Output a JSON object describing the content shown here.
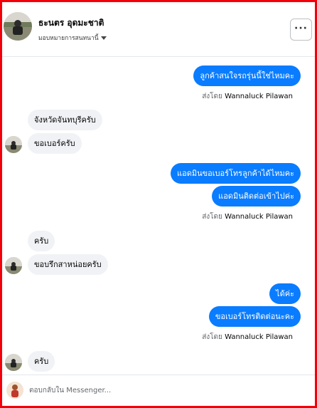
{
  "header": {
    "name": "ธะนตร อุดมะชาติ",
    "subtitle": "มอบหมายการสนทนานี้",
    "more_label": "···"
  },
  "messages": [
    {
      "type": "out",
      "text": "ลูกค้าสนใจรถรุ่นนี้ใช่ไหมคะ"
    },
    {
      "type": "sentby",
      "prefix": "ส่งโดย",
      "agent": "Wannaluck Pilawan"
    },
    {
      "type": "in",
      "text": "จังหวัดจันทบุรีครับ"
    },
    {
      "type": "in",
      "text": "ขอเบอร์ครับ"
    },
    {
      "type": "out",
      "text": "แอดมินขอเบอร์โทรลูกค้าได้ไหมคะ"
    },
    {
      "type": "out",
      "text": "แอดมินติดต่อเข้าไปค่ะ"
    },
    {
      "type": "sentby",
      "prefix": "ส่งโดย",
      "agent": "Wannaluck Pilawan"
    },
    {
      "type": "in",
      "text": "ครับ"
    },
    {
      "type": "in",
      "text": "ขอบรึกสาหน่อยครับ"
    },
    {
      "type": "out",
      "text": "ได้ค่ะ"
    },
    {
      "type": "out",
      "text": "ขอเบอร์โทรติดต่อนะคะ"
    },
    {
      "type": "sentby",
      "prefix": "ส่งโดย",
      "agent": "Wannaluck Pilawan"
    },
    {
      "type": "in",
      "text": "ครับ"
    }
  ],
  "footer": {
    "placeholder": "ตอบกลับใน Messenger..."
  },
  "colors": {
    "outgoing_bubble": "#0a7cff",
    "incoming_bubble": "#f0f2f5",
    "frame_border": "#f2000a"
  },
  "icons": [
    "more-options-icon",
    "chevron-down-icon"
  ]
}
